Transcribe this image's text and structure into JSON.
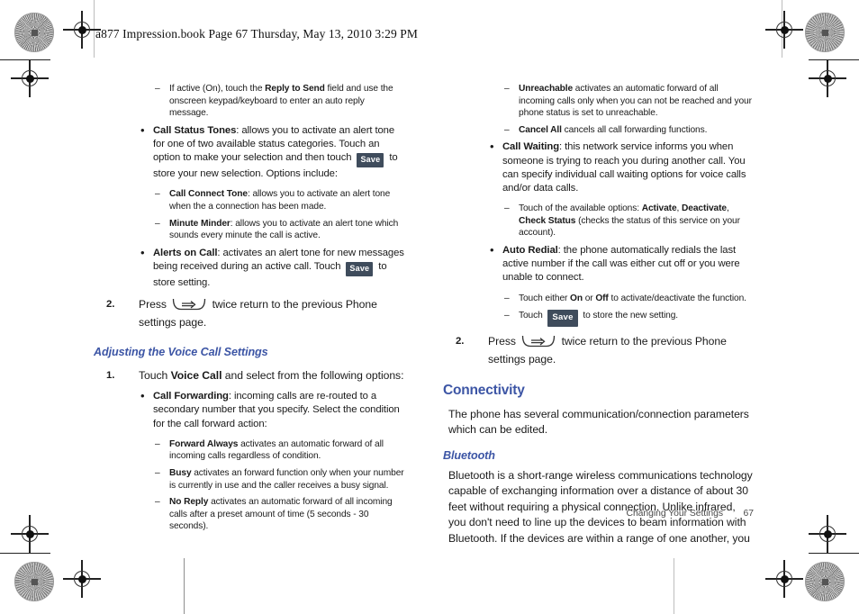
{
  "page": {
    "running_header": "a877 Impression.book  Page 67  Thursday, May 13, 2010  3:29 PM",
    "footer_chapter": "Changing Your Settings",
    "footer_page_number": "67",
    "accent_color": "#3c55a5",
    "key_button_color": "#3f4c5c"
  },
  "icons": {
    "save_key_label": "Save",
    "back_key_name": "back-key-icon"
  },
  "left_column": {
    "blocks": [
      {
        "type": "dash",
        "bold": "Reply to Send",
        "pre": "If active (On), touch the ",
        "post": " field and use the onscreen keypad/keyboard to enter an auto reply message."
      },
      {
        "type": "bullet",
        "bold": "Call Status Tones",
        "pre": "",
        "post": ": allows you to activate an alert tone for one of two available status categories. Touch an option to make your selection and then touch ",
        "has_save_key": true,
        "tail": " to store your new selection. Options include:"
      },
      {
        "type": "dash",
        "bold": "Call Connect Tone",
        "pre": "",
        "post": ": allows you to activate an alert tone when the a connection has been made."
      },
      {
        "type": "dash",
        "bold": "Minute Minder",
        "pre": "",
        "post": ": allows you to activate an alert tone which sounds every minute the call is active."
      },
      {
        "type": "bullet",
        "bold": "Alerts on Call",
        "pre": "",
        "post": ": activates an alert tone for new messages being received during an active call. Touch ",
        "has_save_key": true,
        "tail": " to store setting."
      },
      {
        "type": "step",
        "number": "2.",
        "pre": "Press ",
        "has_back_key": true,
        "post": " twice return to the previous Phone settings page."
      }
    ],
    "section": {
      "heading": "Adjusting the Voice Call Settings",
      "step_number": "1.",
      "step_pre": "Touch ",
      "step_bold": "Voice Call",
      "step_post": " and select from the following options:",
      "items": [
        {
          "type": "bullet",
          "bold": "Call Forwarding",
          "post": ": incoming calls are re-routed to a secondary number that you specify. Select the condition for the call forward action:"
        },
        {
          "type": "dash",
          "bold": "Forward Always",
          "post": " activates an automatic forward of all incoming calls regardless of condition."
        },
        {
          "type": "dash",
          "bold": "Busy",
          "post": " activates an forward function only when your number is currently in use and the caller receives a busy signal."
        },
        {
          "type": "dash",
          "bold": "No Reply",
          "post": " activates an automatic forward of all incoming calls after a preset amount of time (5 seconds - 30 seconds)."
        }
      ]
    }
  },
  "right_column": {
    "blocks": [
      {
        "type": "dash",
        "bold": "Unreachable",
        "post": " activates an automatic forward of all incoming calls only when you can not be reached and your phone status is set to unreachable."
      },
      {
        "type": "dash",
        "bold": "Cancel All",
        "post": " cancels all call forwarding functions."
      },
      {
        "type": "bullet",
        "bold": "Call Waiting",
        "post": ": this network service informs you when someone is trying to reach you during another call. You can specify individual call waiting options for voice calls and/or data calls."
      },
      {
        "type": "dash-options",
        "pre": "Touch of the available options: ",
        "options": [
          "Activate",
          "Deactivate",
          "Check Status"
        ],
        "post": " (checks the status of this service on your account)."
      },
      {
        "type": "bullet",
        "bold": "Auto Redial",
        "post": ": the phone automatically redials the last active number if the call was either cut off or you were unable to connect."
      },
      {
        "type": "dash-onoff",
        "pre": "Touch either ",
        "on": "On",
        "mid": " or ",
        "off": "Off",
        "post": " to activate/deactivate the function."
      },
      {
        "type": "dash-save",
        "pre": "Touch ",
        "post": " to store the new setting."
      },
      {
        "type": "step",
        "number": "2.",
        "pre": "Press ",
        "has_back_key": true,
        "post": " twice return to the previous Phone settings page."
      }
    ],
    "connectivity": {
      "heading": "Connectivity",
      "intro": "The phone has several communication/connection parameters which can be edited.",
      "sub_heading": "Bluetooth",
      "sub_body": "Bluetooth is a short-range wireless communications technology capable of exchanging information over a distance of about 30 feet without requiring a physical connection. Unlike infrared, you don't need to line up the devices to beam information with Bluetooth. If the devices are within a range of one another, you"
    }
  }
}
